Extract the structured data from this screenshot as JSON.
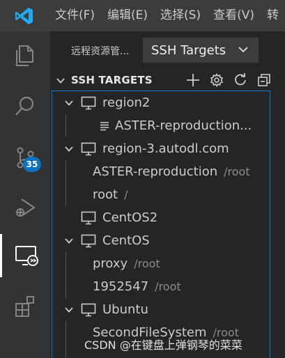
{
  "menubar": {
    "items": [
      "文件(F)",
      "编辑(E)",
      "选择(S)",
      "查看(V)",
      "转"
    ]
  },
  "activity_bar": {
    "source_control_badge": "35",
    "items": [
      "explorer",
      "search",
      "source-control",
      "run-debug",
      "remote-explorer",
      "extensions"
    ],
    "active": "remote-explorer"
  },
  "sidebar": {
    "title": "远程资源管...",
    "dropdown": {
      "selected": "SSH Targets"
    },
    "section": {
      "title": "SSH TARGETS",
      "actions": [
        "add-icon",
        "gear-icon",
        "refresh-icon",
        "collapse-all-icon"
      ]
    },
    "tree": [
      {
        "kind": "host",
        "label": "region2",
        "expanded": true
      },
      {
        "kind": "file",
        "label": "ASTER-reproduction..."
      },
      {
        "kind": "host",
        "label": "region-3.autodl.com",
        "expanded": true
      },
      {
        "kind": "folder",
        "label": "ASTER-reproduction",
        "desc": "/root"
      },
      {
        "kind": "folder",
        "label": "root",
        "desc": "/"
      },
      {
        "kind": "host",
        "label": "CentOS2",
        "expanded": false
      },
      {
        "kind": "host",
        "label": "CentOS",
        "expanded": true
      },
      {
        "kind": "folder",
        "label": "proxy",
        "desc": "/root"
      },
      {
        "kind": "folder",
        "label": "1952547",
        "desc": "/root"
      },
      {
        "kind": "host",
        "label": "Ubuntu",
        "expanded": true
      },
      {
        "kind": "folder",
        "label": "SecondFileSystem",
        "desc": "/root"
      }
    ]
  },
  "watermark": "CSDN @在键盘上弹钢琴的菜菜",
  "colors": {
    "accent": "#007fd4",
    "badge": "#0e70c0",
    "logo": "#23a9f2"
  }
}
